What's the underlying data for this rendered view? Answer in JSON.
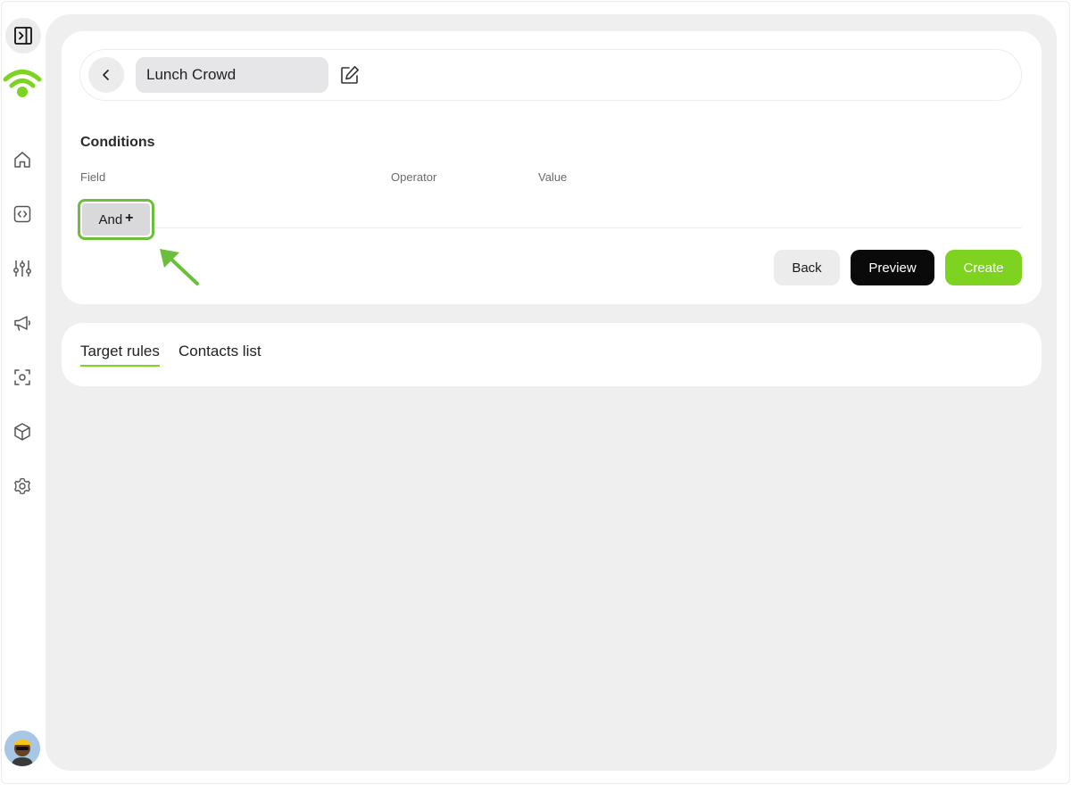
{
  "header": {
    "segment_name": "Lunch Crowd"
  },
  "conditions": {
    "title": "Conditions",
    "columns": [
      "Field",
      "Operator",
      "Value"
    ],
    "and_label": "And",
    "and_icon": "+"
  },
  "actions": {
    "back_label": "Back",
    "preview_label": "Preview",
    "create_label": "Create"
  },
  "tabs": [
    {
      "label": "Target rules",
      "active": true
    },
    {
      "label": "Contacts list",
      "active": false
    }
  ],
  "sidebar": {
    "icons": [
      "sidebar-toggle-icon",
      "wifi-logo-icon",
      "home-icon",
      "code-icon",
      "sliders-icon",
      "megaphone-icon",
      "scan-icon",
      "cube-icon",
      "gear-icon"
    ]
  },
  "colors": {
    "accent": "#7ed321",
    "highlight": "#6cbf3a",
    "primary_dark": "#0a0a0a",
    "background": "#efefef"
  }
}
